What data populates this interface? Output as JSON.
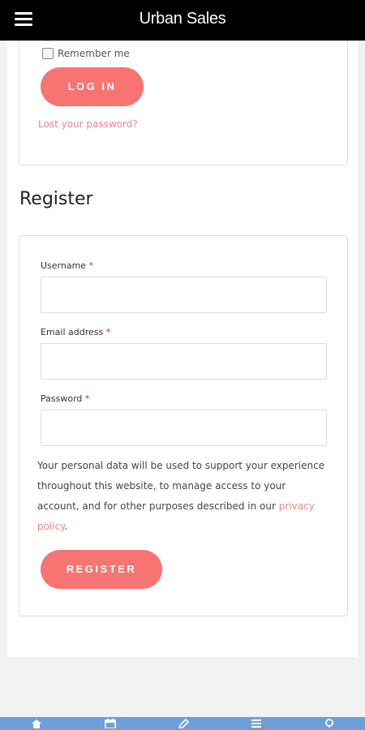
{
  "header": {
    "title": "Urban Sales",
    "menu_icon": "hamburger-menu-icon"
  },
  "login": {
    "remember_label": "Remember me",
    "login_button": "LOG IN",
    "lost_password": "Lost your password?"
  },
  "register": {
    "heading": "Register",
    "fields": [
      {
        "label": "Username",
        "required_mark": "*",
        "value": ""
      },
      {
        "label": "Email address",
        "required_mark": "*",
        "value": ""
      },
      {
        "label": "Password",
        "required_mark": "*",
        "value": ""
      }
    ],
    "privacy_text_before": "Your personal data will be used to support your experience throughout this website, to manage access to your account, and for other purposes described in our ",
    "privacy_link": "privacy policy",
    "privacy_text_after": ".",
    "register_button": "REGISTER"
  },
  "bottom_nav": {
    "icons": [
      "home-icon",
      "calendar-icon",
      "edit-icon",
      "news-icon",
      "location-pin-icon"
    ]
  },
  "colors": {
    "accent": "#f77472",
    "link": "#e98787",
    "header_bg": "#000000",
    "nav_bg": "#6e9fd6",
    "required": "#d92525"
  }
}
